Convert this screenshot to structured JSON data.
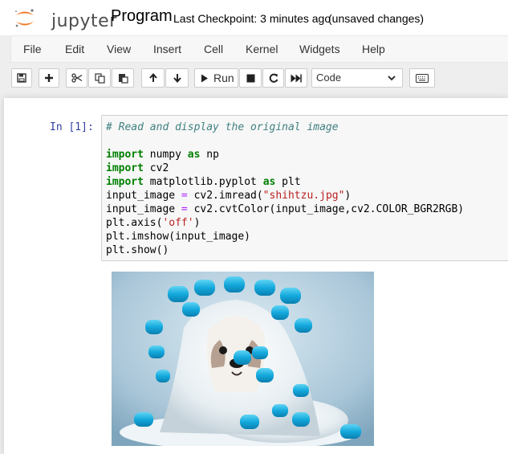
{
  "header": {
    "logo_text": "jupyter",
    "notebook_name": "Program",
    "checkpoint": "Last Checkpoint: 3 minutes ago",
    "autosave": "(unsaved changes)"
  },
  "menu": [
    "File",
    "Edit",
    "View",
    "Insert",
    "Cell",
    "Kernel",
    "Widgets",
    "Help"
  ],
  "toolbar": {
    "run_label": "Run",
    "cell_type": "Code"
  },
  "cell": {
    "prompt": "In [1]:",
    "code_lines": [
      "# Read and display the original image",
      "",
      "import numpy as np",
      "import cv2",
      "import matplotlib.pyplot as plt",
      "input_image = cv2.imread(\"shihtzu.jpg\")",
      "input_image = cv2.cvtColor(input_image,cv2.COLOR_BGR2RGB)",
      "plt.axis('off')",
      "plt.imshow(input_image)",
      "plt.show()"
    ]
  },
  "output": {
    "image_subject": "shih-tzu-dog-with-blue-hair-curlers"
  },
  "colors": {
    "brand_orange": "#f37726",
    "prompt_blue": "#303f9f",
    "keyword_green": "#008000",
    "string_red": "#ba2121",
    "comment_teal": "#408080"
  }
}
